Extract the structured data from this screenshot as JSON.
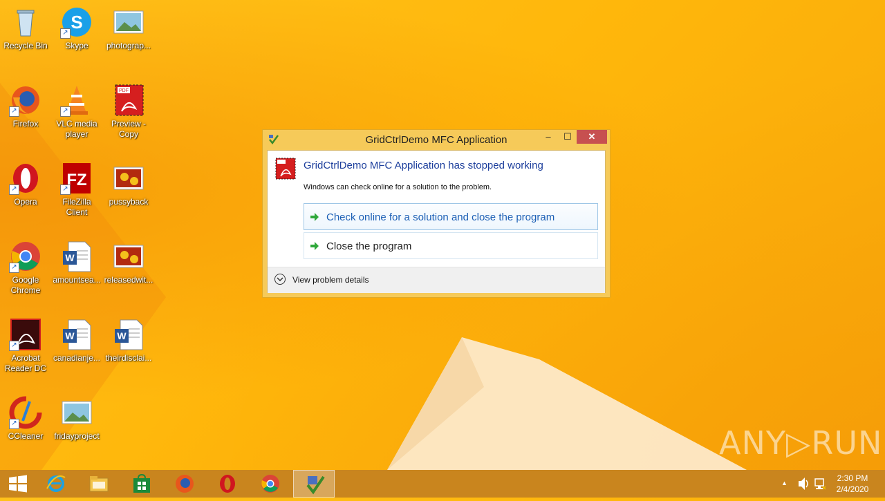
{
  "desktop": {
    "icons": [
      {
        "label": "Recycle Bin"
      },
      {
        "label": "Skype"
      },
      {
        "label": "photograp..."
      },
      {
        "label": "Firefox"
      },
      {
        "label": "VLC media\nplayer"
      },
      {
        "label": "Preview -\nCopy"
      },
      {
        "label": "Opera"
      },
      {
        "label": "FileZilla\nClient"
      },
      {
        "label": "pussyback"
      },
      {
        "label": "Google\nChrome"
      },
      {
        "label": "amountsea..."
      },
      {
        "label": "releasedwit..."
      },
      {
        "label": "Acrobat\nReader DC"
      },
      {
        "label": "canadianje..."
      },
      {
        "label": "theirdisclai..."
      },
      {
        "label": "CCleaner"
      },
      {
        "label": "fridayproject"
      }
    ]
  },
  "dialog": {
    "title": "GridCtrlDemo MFC Application",
    "heading": "GridCtrlDemo MFC Application has stopped working",
    "subtext": "Windows can check online for a solution to the problem.",
    "option_check": "Check online for a solution and close the program",
    "option_close": "Close the program",
    "details": "View problem details",
    "minimize_glyph": "–",
    "maximize_glyph": "☐",
    "close_glyph": "✕"
  },
  "watermark": {
    "text": "ANY▷RUN"
  },
  "taskbar": {
    "clock_time": "2:30 PM",
    "clock_date": "2/4/2020",
    "tray_chevron": "▲"
  },
  "colors": {
    "wallpaper": "#ffb70b",
    "taskbar": "#c9851e",
    "close_button": "#c75050",
    "link_blue": "#1c5fb5"
  }
}
